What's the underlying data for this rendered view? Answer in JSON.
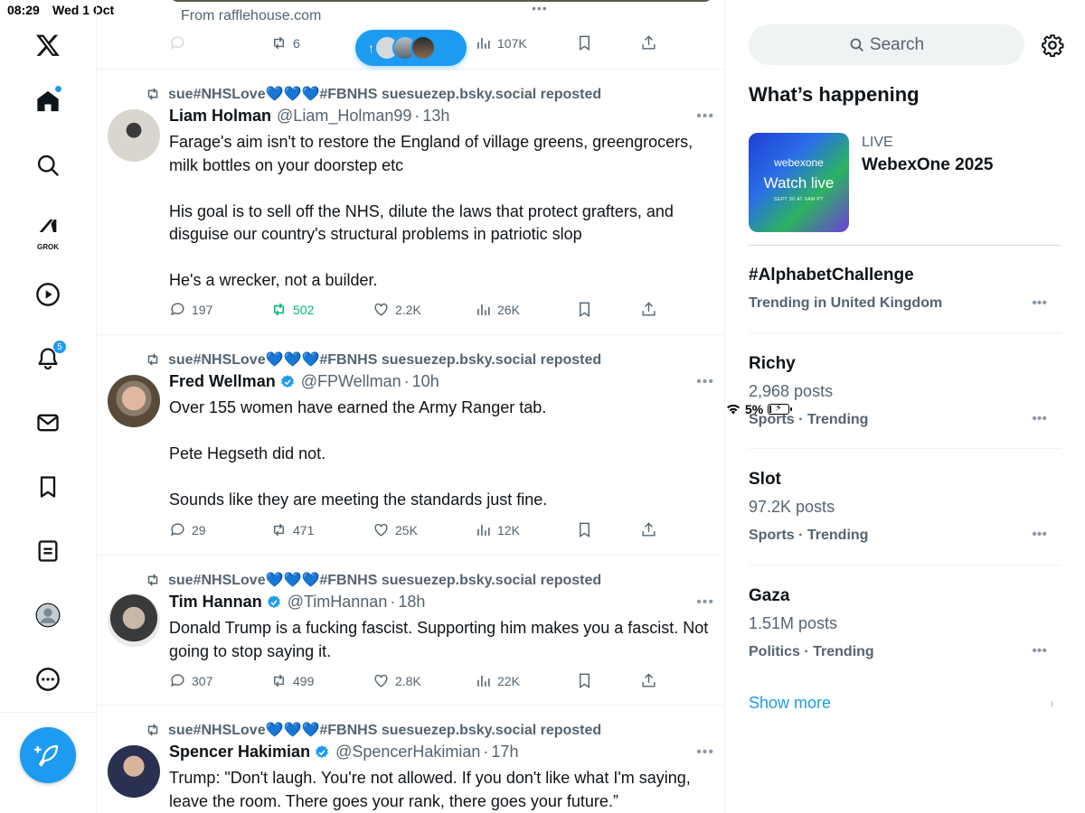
{
  "status": {
    "time": "08:29",
    "date": "Wed 1 Oct",
    "battery": "5%",
    "battery_level": 0.05
  },
  "nav": {
    "grok_label": "GROK",
    "notifications_badge": "5"
  },
  "feed": {
    "top": {
      "from": "From rafflehouse.com",
      "retweets": "6",
      "views": "107K"
    },
    "tweets": [
      {
        "reposted_by": "sue#NHSLove💙💙💙#FBNHS suesuezep.bsky.social reposted",
        "name": "Liam Holman",
        "handle": "@Liam_Holman99",
        "time": "13h",
        "text": "Farage's aim isn't to restore the England of village greens, greengrocers, milk bottles on your doorstep etc\n\nHis goal is to sell off the NHS, dilute the laws that protect grafters, and disguise our country's structural problems in patriotic slop\n\nHe's a wrecker, not a builder.",
        "replies": "197",
        "retweets": "502",
        "likes": "2.2K",
        "views": "26K"
      },
      {
        "reposted_by": "sue#NHSLove💙💙💙#FBNHS suesuezep.bsky.social reposted",
        "name": "Fred Wellman",
        "handle": "@FPWellman",
        "time": "10h",
        "text": "Over 155 women have earned the Army Ranger tab.\n\nPete Hegseth did not.\n\nSounds like they are meeting the standards just fine.",
        "replies": "29",
        "retweets": "471",
        "likes": "25K",
        "views": "12K"
      },
      {
        "reposted_by": "sue#NHSLove💙💙💙#FBNHS suesuezep.bsky.social reposted",
        "name": "Tim Hannan",
        "handle": "@TimHannan",
        "time": "18h",
        "text": "Donald Trump is a fucking fascist. Supporting him makes you a fascist. Not going to stop saying it.",
        "replies": "307",
        "retweets": "499",
        "likes": "2.8K",
        "views": "22K"
      },
      {
        "reposted_by": "sue#NHSLove💙💙💙#FBNHS suesuezep.bsky.social reposted",
        "name": "Spencer Hakimian",
        "handle": "@SpencerHakimian",
        "time": "17h",
        "text": "Trump: \"Don't laugh. You're not allowed. If you don't like what I'm saying, leave the room. There goes your rank, there goes your future.”"
      }
    ]
  },
  "right": {
    "search_placeholder": "Search",
    "whats_happening": "What’s happening",
    "live": {
      "label": "LIVE",
      "title": "WebexOne 2025",
      "thumb_brand": "webexone",
      "thumb_cta": "Watch live",
      "thumb_sub": "SEPT 30 AT 9AM PT"
    },
    "trends": [
      {
        "name": "#AlphabetChallenge",
        "category": "Trending in United Kingdom"
      },
      {
        "name": "Richy",
        "count": "2,968 posts",
        "category": "Sports · Trending"
      },
      {
        "name": "Slot",
        "count": "97.2K posts",
        "category": "Sports · Trending"
      },
      {
        "name": "Gaza",
        "count": "1.51M posts",
        "category": "Politics · Trending"
      }
    ],
    "show_more": "Show more"
  },
  "colors": {
    "accent": "#1d9bf0",
    "retweet_active": "#00ba7c",
    "text": "#0f1419",
    "muted": "#536471"
  }
}
